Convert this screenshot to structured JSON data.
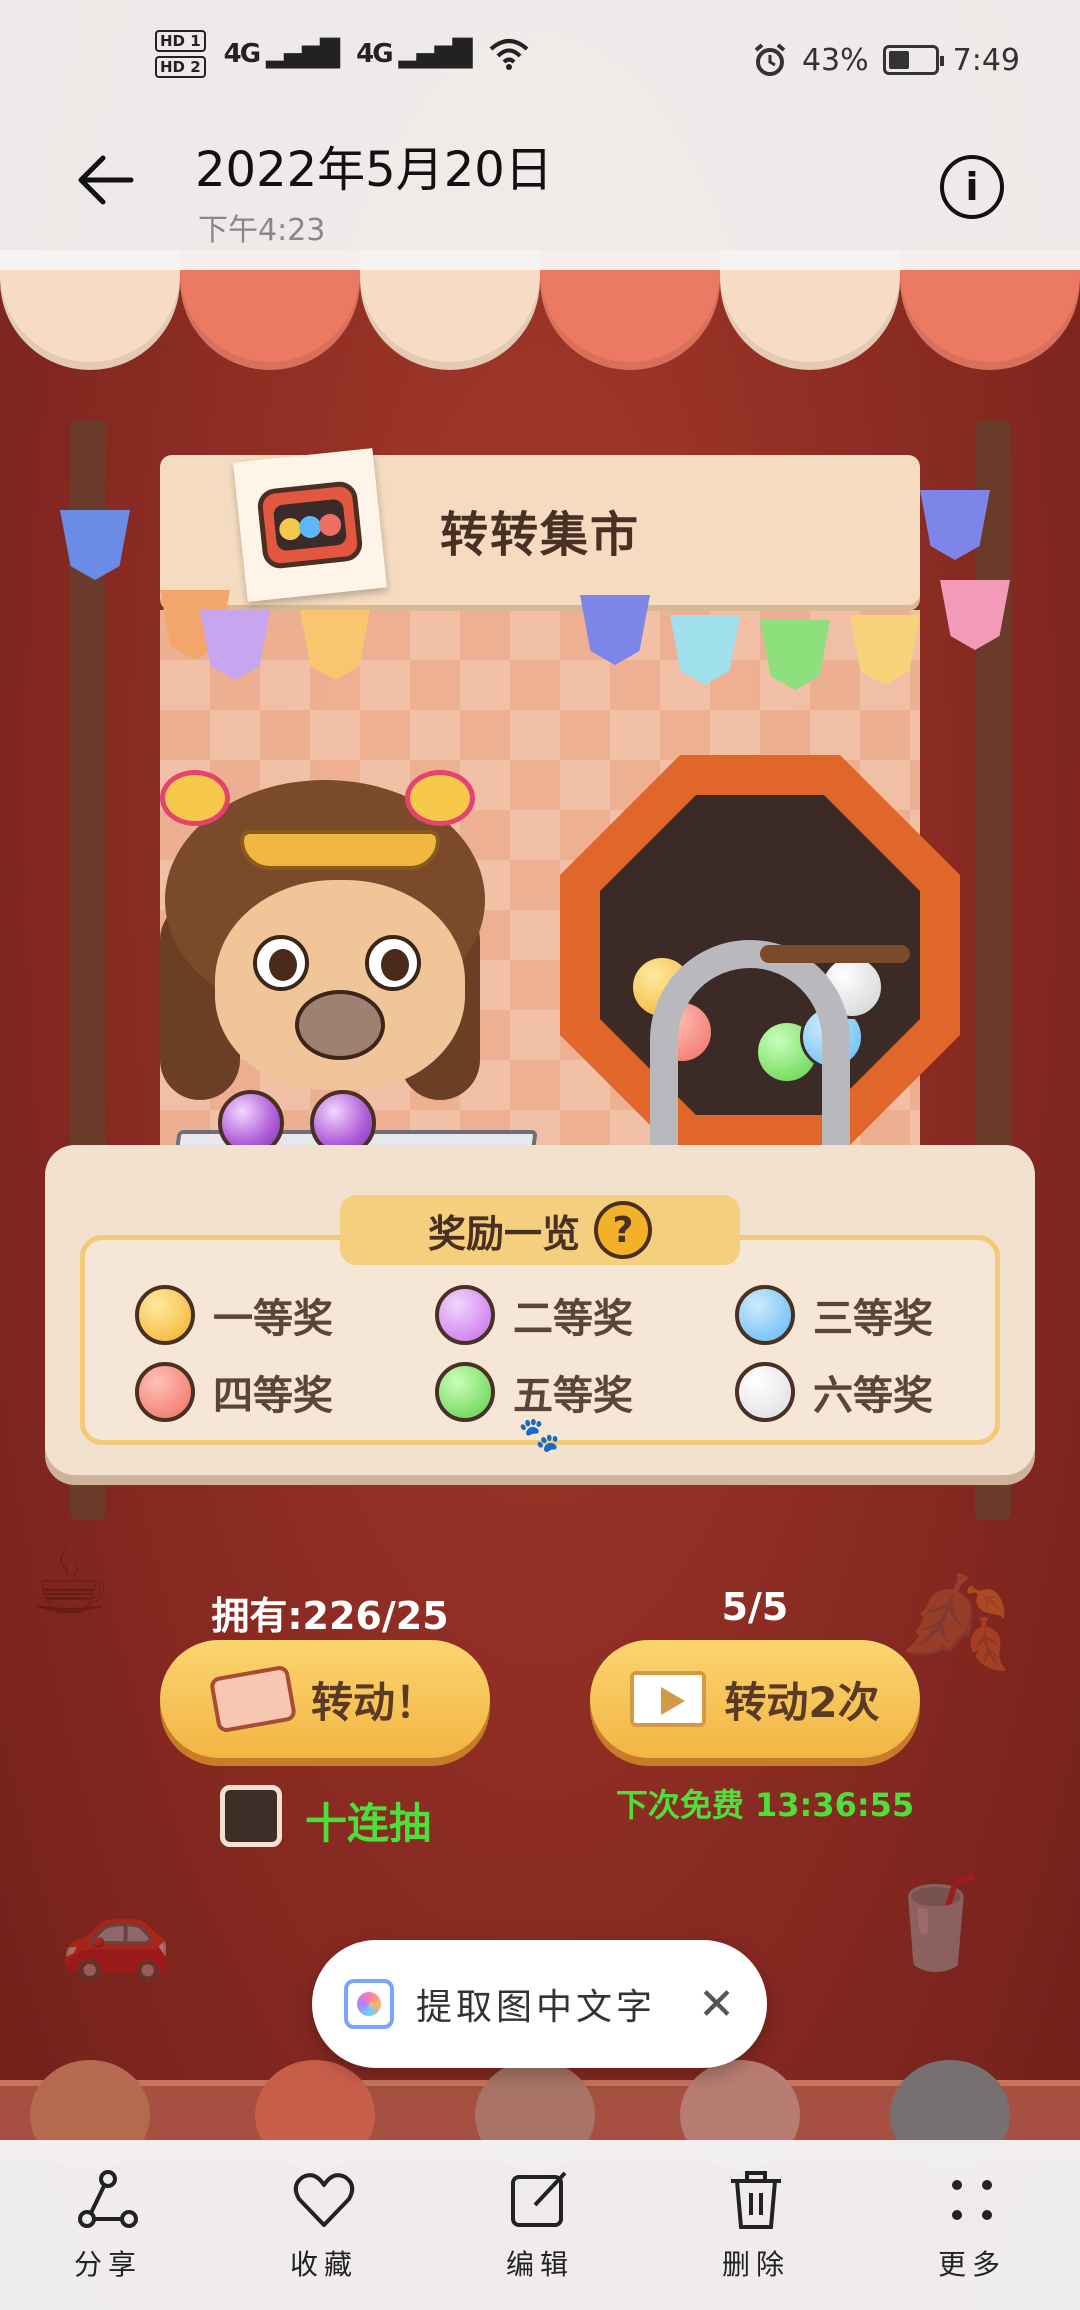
{
  "status_bar": {
    "hd1": "HD 1",
    "hd2": "HD 2",
    "signal1": "4G",
    "signal2": "4G",
    "battery": "43%",
    "time": "7:49"
  },
  "header": {
    "title": "2022年5月20日",
    "subtitle": "下午4:23"
  },
  "game": {
    "booth_title": "转转集市",
    "reward_title": "奖励一览",
    "help_symbol": "?",
    "prizes": [
      {
        "label": "一等奖",
        "color": "#f2b128"
      },
      {
        "label": "二等奖",
        "color": "#c46be6"
      },
      {
        "label": "三等奖",
        "color": "#5db8f5"
      },
      {
        "label": "四等奖",
        "color": "#ef6e63"
      },
      {
        "label": "五等奖",
        "color": "#5fcf4a"
      },
      {
        "label": "六等奖",
        "color": "#eeeeee"
      }
    ],
    "owned": "拥有:226/25",
    "spin_label": "转动！",
    "free_count": "5/5",
    "spin_twice_label": "转动2次",
    "ten_draw_label": "十连抽",
    "next_free": "下次免费 13:36:55"
  },
  "ocr": {
    "label": "提取图中文字",
    "close": "✕"
  },
  "bottom_actions": [
    {
      "label": "分享",
      "icon": "share-icon"
    },
    {
      "label": "收藏",
      "icon": "heart-icon"
    },
    {
      "label": "编辑",
      "icon": "edit-icon"
    },
    {
      "label": "删除",
      "icon": "trash-icon"
    },
    {
      "label": "更多",
      "icon": "more-icon"
    }
  ]
}
